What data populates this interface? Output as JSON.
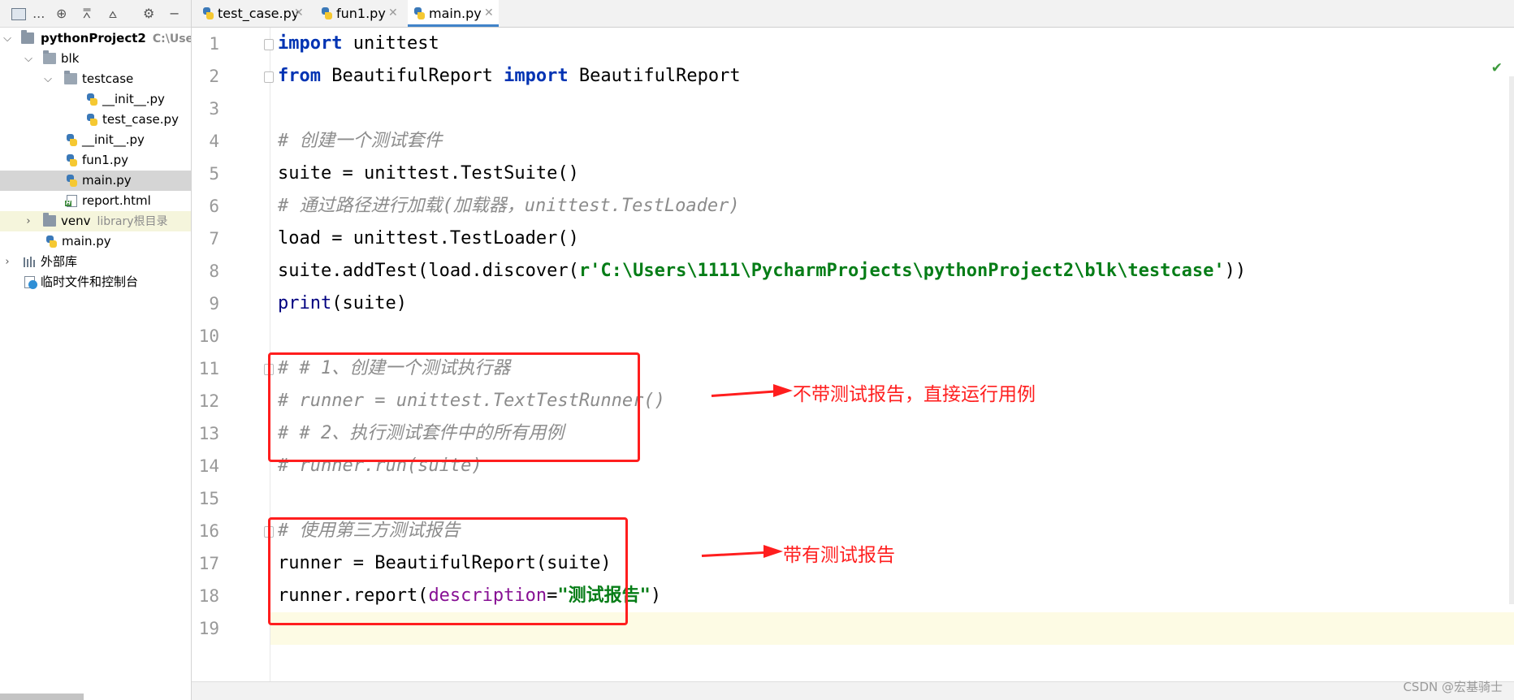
{
  "toolbar": {
    "panel_label": "...",
    "locate_icon": "crosshair-icon",
    "expand_icon": "expand-all-icon",
    "collapse_icon": "collapse-all-icon",
    "settings_icon": "gear-icon",
    "hide_icon": "minimize-icon"
  },
  "tree": {
    "root": {
      "name": "pythonProject2",
      "path": "C:\\Users"
    },
    "items": [
      {
        "name": "blk"
      },
      {
        "name": "testcase"
      },
      {
        "name": "__init__.py"
      },
      {
        "name": "test_case.py"
      },
      {
        "name": "__init__.py"
      },
      {
        "name": "fun1.py"
      },
      {
        "name": "main.py"
      },
      {
        "name": "report.html"
      },
      {
        "name": "venv",
        "hint": "library根目录"
      },
      {
        "name": "main.py"
      },
      {
        "name": "外部库"
      },
      {
        "name": "临时文件和控制台"
      }
    ]
  },
  "tabs": [
    {
      "label": "test_case.py"
    },
    {
      "label": "fun1.py"
    },
    {
      "label": "main.py",
      "active": true
    }
  ],
  "line_numbers": [
    "1",
    "2",
    "3",
    "4",
    "5",
    "6",
    "7",
    "8",
    "9",
    "10",
    "11",
    "12",
    "13",
    "14",
    "15",
    "16",
    "17",
    "18",
    "19"
  ],
  "code": {
    "l1_kw": "import",
    "l1_rest": " unittest",
    "l2_kw1": "from",
    "l2_mid": " BeautifulReport ",
    "l2_kw2": "import",
    "l2_rest": " BeautifulReport",
    "l4": "# 创建一个测试套件",
    "l5": "suite = unittest.TestSuite()",
    "l6": "# 通过路径进行加载(加载器，unittest.TestLoader)",
    "l7": "load = unittest.TestLoader()",
    "l8_pre": "suite.addTest(load.discover(",
    "l8_str": "r'C:\\Users\\1111\\PycharmProjects\\pythonProject2\\blk\\testcase'",
    "l8_post": "))",
    "l9_fn": "print",
    "l9_rest": "(suite)",
    "l11": "# # 1、创建一个测试执行器",
    "l12": "# runner = unittest.TextTestRunner()",
    "l13": "# # 2、执行测试套件中的所有用例",
    "l14": "# runner.run(suite)",
    "l16": "# 使用第三方测试报告",
    "l17": "runner = BeautifulReport(suite)",
    "l18_pre": "runner.report(",
    "l18_param": "description",
    "l18_eq": "=",
    "l18_str": "\"测试报告\"",
    "l18_post": ")"
  },
  "annotations": {
    "note1": "不带测试报告，直接运行用例",
    "note2": "带有测试报告"
  },
  "status": {
    "check_icon": "check-icon"
  },
  "watermark": "CSDN @宏基骑士",
  "colors": {
    "keyword": "#0033b3",
    "comment": "#8c8c8c",
    "string": "#067d17",
    "param": "#871094",
    "annotation": "#ff1e1e",
    "tab_accent": "#4083c9"
  }
}
